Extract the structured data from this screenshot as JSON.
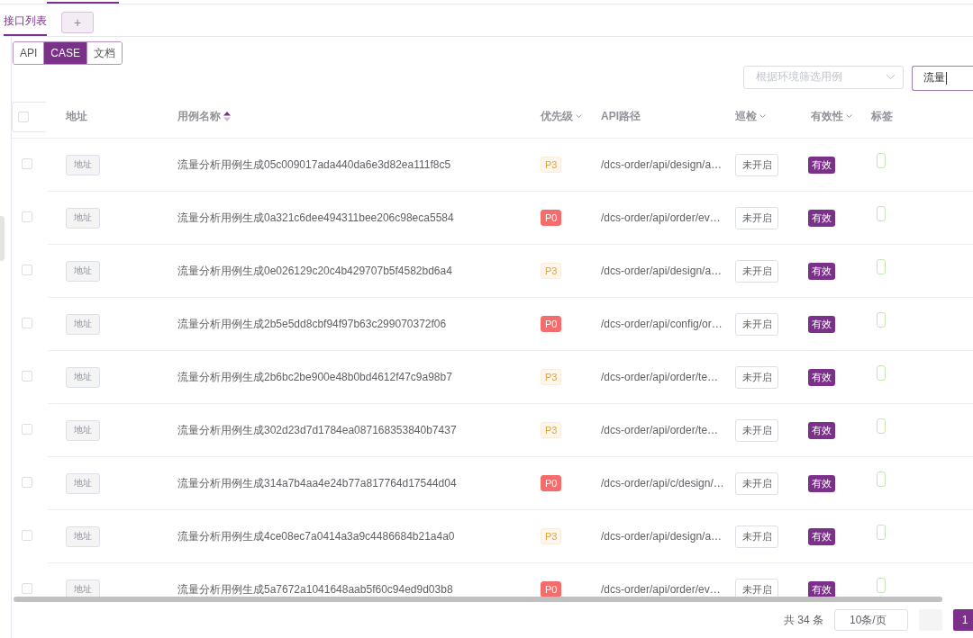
{
  "tabs": [
    {
      "label": "接口列表",
      "selected": true
    }
  ],
  "add_tab": {
    "label": "+"
  },
  "view_switch": [
    {
      "label": "API",
      "selected": false
    },
    {
      "label": "CASE",
      "selected": true
    },
    {
      "label": "文档",
      "selected": false
    }
  ],
  "env_filter": {
    "placeholder": "根据环境筛选用例"
  },
  "search": {
    "value": "流量"
  },
  "table": {
    "columns": [
      {
        "label": "地址",
        "kind": "plain"
      },
      {
        "label": "用例名称",
        "kind": "sort"
      },
      {
        "label": "优先级",
        "kind": "filter"
      },
      {
        "label": "API路径",
        "kind": "plain"
      },
      {
        "label": "巡检",
        "kind": "filter"
      },
      {
        "label": "有效性",
        "kind": "filter"
      },
      {
        "label": "标签",
        "kind": "plain"
      }
    ],
    "header_checked": false,
    "rows": [
      {
        "checked": false,
        "address": "地址",
        "name": "流量分析用例生成05c009017ada440da6e3d82ea111f8c5",
        "priority": "P3",
        "kind": "low",
        "path": "/dcs-order/api/design/a…",
        "patrol": "未开启",
        "validity": "有效"
      },
      {
        "checked": false,
        "address": "地址",
        "name": "流量分析用例生成0a321c6dee494311bee206c98eca5584",
        "priority": "P0",
        "kind": "high",
        "path": "/dcs-order/api/order/ev…",
        "patrol": "未开启",
        "validity": "有效"
      },
      {
        "checked": false,
        "address": "地址",
        "name": "流量分析用例生成0e026129c20c4b429707b5f4582bd6a4",
        "priority": "P3",
        "kind": "low",
        "path": "/dcs-order/api/design/a…",
        "patrol": "未开启",
        "validity": "有效"
      },
      {
        "checked": false,
        "address": "地址",
        "name": "流量分析用例生成2b5e5dd8cbf94f97b63c299070372f06",
        "priority": "P0",
        "kind": "high",
        "path": "/dcs-order/api/config/or…",
        "patrol": "未开启",
        "validity": "有效"
      },
      {
        "checked": false,
        "address": "地址",
        "name": "流量分析用例生成2b6bc2be900e48b0bd4612f47c9a98b7",
        "priority": "P3",
        "kind": "low",
        "path": "/dcs-order/api/order/te…",
        "patrol": "未开启",
        "validity": "有效"
      },
      {
        "checked": false,
        "address": "地址",
        "name": "流量分析用例生成302d23d7d1784ea087168353840b7437",
        "priority": "P3",
        "kind": "low",
        "path": "/dcs-order/api/order/te…",
        "patrol": "未开启",
        "validity": "有效"
      },
      {
        "checked": false,
        "address": "地址",
        "name": "流量分析用例生成314a7b4aa4e24b77a817764d17544d04",
        "priority": "P0",
        "kind": "high",
        "path": "/dcs-order/api/c/design/…",
        "patrol": "未开启",
        "validity": "有效"
      },
      {
        "checked": false,
        "address": "地址",
        "name": "流量分析用例生成4ce08ec7a0414a3a9c4486684b21a4a0",
        "priority": "P3",
        "kind": "low",
        "path": "/dcs-order/api/design/a…",
        "patrol": "未开启",
        "validity": "有效"
      },
      {
        "checked": false,
        "address": "地址",
        "name": "流量分析用例生成5a7672a1041648aab5f60c94ed9d03b8",
        "priority": "P0",
        "kind": "high",
        "path": "/dcs-order/api/order/ev…",
        "patrol": "未开启",
        "validity": "有效"
      }
    ]
  },
  "pagination": {
    "total": "共 34 条",
    "page_size": "10条/页",
    "pages": [
      {
        "label": "1",
        "selected": true
      }
    ]
  }
}
